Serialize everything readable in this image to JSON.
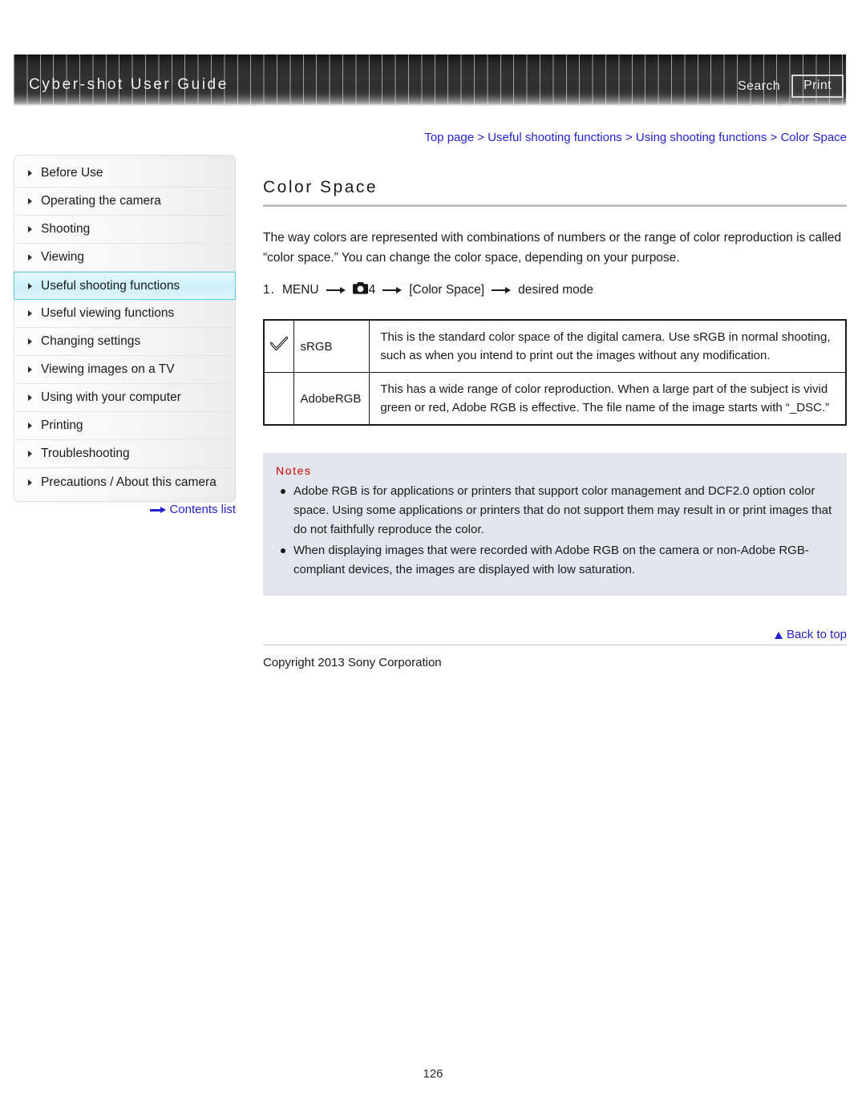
{
  "header": {
    "title": "Cyber-shot User Guide",
    "search_label": "Search",
    "print_label": "Print"
  },
  "breadcrumb": {
    "items": [
      "Top page",
      "Useful shooting functions",
      "Using shooting functions",
      "Color Space"
    ],
    "separator": ">"
  },
  "sidebar": {
    "items": [
      {
        "label": "Before Use",
        "active": false
      },
      {
        "label": "Operating the camera",
        "active": false
      },
      {
        "label": "Shooting",
        "active": false
      },
      {
        "label": "Viewing",
        "active": false
      },
      {
        "label": "Useful shooting functions",
        "active": true
      },
      {
        "label": "Useful viewing functions",
        "active": false
      },
      {
        "label": "Changing settings",
        "active": false
      },
      {
        "label": "Viewing images on a TV",
        "active": false
      },
      {
        "label": "Using with your computer",
        "active": false
      },
      {
        "label": "Printing",
        "active": false
      },
      {
        "label": "Troubleshooting",
        "active": false
      },
      {
        "label": "Precautions / About this camera",
        "active": false
      }
    ],
    "contents_link": "Contents list"
  },
  "main": {
    "heading": "Color Space",
    "intro": "The way colors are represented with combinations of numbers or the range of color reproduction is called “color space.” You can change the color space, depending on your purpose.",
    "step": {
      "number": "1.",
      "menu_label": "MENU",
      "camera_icon_label": "camera-icon",
      "page_number": "4",
      "setting_label": "[Color Space]",
      "result_label": "desired mode"
    },
    "table": {
      "rows": [
        {
          "checked": true,
          "name": "sRGB",
          "description": "This is the standard color space of the digital camera. Use sRGB in normal shooting, such as when you intend to print out the images without any modification."
        },
        {
          "checked": false,
          "name": "AdobeRGB",
          "description": "This has a wide range of color reproduction. When a large part of the subject is vivid green or red, Adobe RGB is effective. The file name of the image starts with “_DSC.”"
        }
      ]
    },
    "notes": {
      "title": "Notes",
      "items": [
        "Adobe RGB is for applications or printers that support color management and DCF2.0 option color space. Using some applications or printers that do not support them may result in or print images that do not faithfully reproduce the color.",
        "When displaying images that were recorded with Adobe RGB on the camera or non-Adobe RGB-compliant devices, the images are displayed with low saturation."
      ]
    }
  },
  "footer": {
    "back_to_top": "Back to top",
    "copyright": "Copyright 2013 Sony Corporation",
    "page_number": "126"
  },
  "colors": {
    "link": "#2323cc",
    "notes_title": "#d00000",
    "notes_bg": "#e3e5ec",
    "active_nav_border": "#5fcbe4"
  }
}
